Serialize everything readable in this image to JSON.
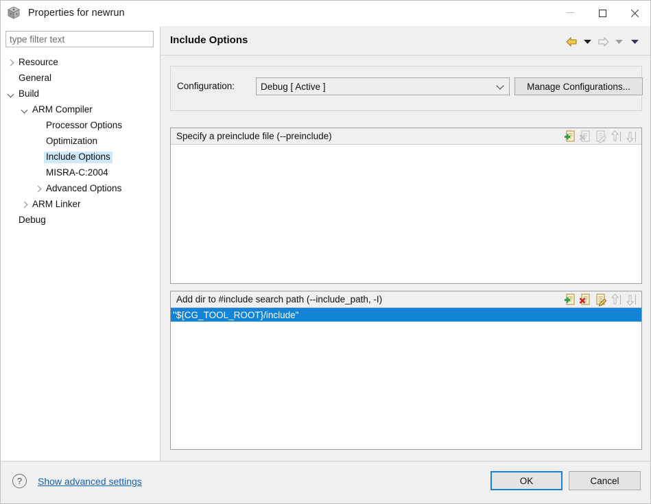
{
  "window": {
    "title": "Properties for newrun",
    "icon": "cube-icon",
    "controls": {
      "minimize": "minimize-icon",
      "maximize": "maximize-icon",
      "close": "close-icon"
    }
  },
  "sidebar": {
    "filter_placeholder": "type filter text",
    "filter_value": "",
    "items": [
      {
        "label": "Resource",
        "indent": 0,
        "state": "collapsed",
        "selected": false
      },
      {
        "label": "General",
        "indent": 0,
        "state": "none",
        "selected": false
      },
      {
        "label": "Build",
        "indent": 0,
        "state": "expanded",
        "selected": false
      },
      {
        "label": "ARM Compiler",
        "indent": 1,
        "state": "expanded",
        "selected": false
      },
      {
        "label": "Processor Options",
        "indent": 2,
        "state": "none",
        "selected": false
      },
      {
        "label": "Optimization",
        "indent": 2,
        "state": "none",
        "selected": false
      },
      {
        "label": "Include Options",
        "indent": 2,
        "state": "none",
        "selected": true
      },
      {
        "label": "MISRA-C:2004",
        "indent": 2,
        "state": "none",
        "selected": false
      },
      {
        "label": "Advanced Options",
        "indent": 2,
        "state": "collapsed",
        "selected": false
      },
      {
        "label": "ARM Linker",
        "indent": 1,
        "state": "collapsed",
        "selected": false
      },
      {
        "label": "Debug",
        "indent": 0,
        "state": "none",
        "selected": false
      }
    ]
  },
  "content": {
    "title": "Include Options",
    "nav": {
      "back": "back-arrow-icon",
      "back_menu": "back-dropdown-icon",
      "forward": "forward-arrow-icon",
      "forward_menu": "forward-dropdown-icon",
      "menu": "view-menu-icon"
    },
    "configuration": {
      "label": "Configuration:",
      "value": "Debug  [ Active ]",
      "manage_label": "Manage Configurations..."
    },
    "panels": [
      {
        "title": "Specify a preinclude file (--preinclude)",
        "items": [],
        "tools": [
          {
            "name": "add-icon",
            "enabled": true
          },
          {
            "name": "delete-icon",
            "enabled": false
          },
          {
            "name": "edit-icon",
            "enabled": false
          },
          {
            "name": "move-up-icon",
            "enabled": false
          },
          {
            "name": "move-down-icon",
            "enabled": false
          }
        ]
      },
      {
        "title": "Add dir to #include search path (--include_path, -I)",
        "items": [
          {
            "text": "\"${CG_TOOL_ROOT}/include\"",
            "selected": true
          }
        ],
        "tools": [
          {
            "name": "add-icon",
            "enabled": true
          },
          {
            "name": "delete-icon",
            "enabled": true
          },
          {
            "name": "edit-icon",
            "enabled": true
          },
          {
            "name": "move-up-icon",
            "enabled": false
          },
          {
            "name": "move-down-icon",
            "enabled": false
          }
        ]
      }
    ]
  },
  "footer": {
    "help_icon": "help-icon",
    "help_glyph": "?",
    "advanced_link": "Show advanced settings",
    "ok_label": "OK",
    "cancel_label": "Cancel"
  },
  "colors": {
    "selection_blue": "#1383d6",
    "tree_selection": "#cde8f7",
    "link": "#1360b8",
    "dialog_bg": "#f0f0f0"
  }
}
